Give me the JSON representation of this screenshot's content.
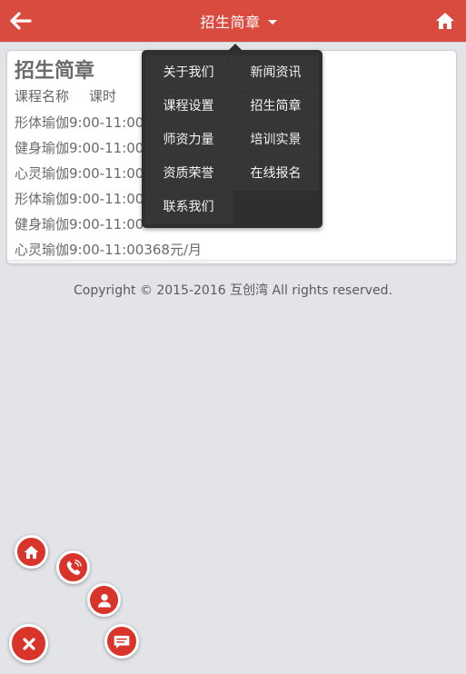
{
  "header": {
    "title": "招生简章",
    "background_color": "#d94a3f",
    "back_icon": "arrow-left-icon",
    "home_icon": "home-icon"
  },
  "card": {
    "title": "招生简章",
    "columns": [
      "课程名称",
      "课时"
    ],
    "rows": [
      "形体瑜伽9:00-11:00",
      "健身瑜伽9:00-11:00",
      "心灵瑜伽9:00-11:00",
      "形体瑜伽9:00-11:00",
      "健身瑜伽9:00-11:00",
      "心灵瑜伽9:00-11:00368元/月"
    ]
  },
  "footer": {
    "text": "Copyright © 2015-2016 互创湾 All rights reserved."
  },
  "dropdown": {
    "items": [
      "关于我们",
      "新闻资讯",
      "课程设置",
      "招生简章",
      "师资力量",
      "培训实景",
      "资质荣誉",
      "在线报名",
      "联系我们"
    ],
    "background_color": "#2f2f2f"
  },
  "fab": {
    "accent_color": "#d9342a",
    "icons": [
      "home-icon",
      "phone-icon",
      "user-icon",
      "message-icon",
      "close-icon"
    ]
  }
}
